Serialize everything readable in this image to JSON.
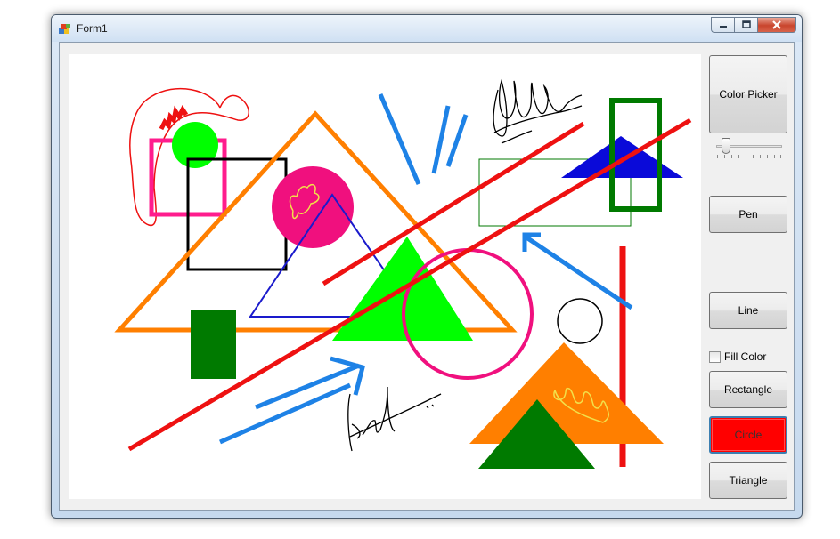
{
  "window": {
    "title": "Form1",
    "title_icon": "winforms-app-icon",
    "caption_buttons": [
      "minimize-icon",
      "maximize-icon",
      "close-icon"
    ]
  },
  "toolbar": {
    "color_picker_label": "Color Picker",
    "pen_label": "Pen",
    "line_label": "Line",
    "fill_color_label": "Fill Color",
    "fill_color_checked": false,
    "rectangle_label": "Rectangle",
    "circle_label": "Circle",
    "triangle_label": "Triangle",
    "selected_tool": "Circle",
    "selected_color": "#ff0000",
    "pen_width_slider_fraction": 0.1
  },
  "canvas": {
    "background": "#ffffff",
    "colors": {
      "orange": "#ff7f00",
      "green": "#00ff00",
      "dark_green": "#007a00",
      "pink": "#ff0080",
      "blue": "#1e82e6",
      "navy": "#0000cc",
      "red": "#ee1111",
      "black": "#000000",
      "yellow": "#f2e04a"
    }
  }
}
